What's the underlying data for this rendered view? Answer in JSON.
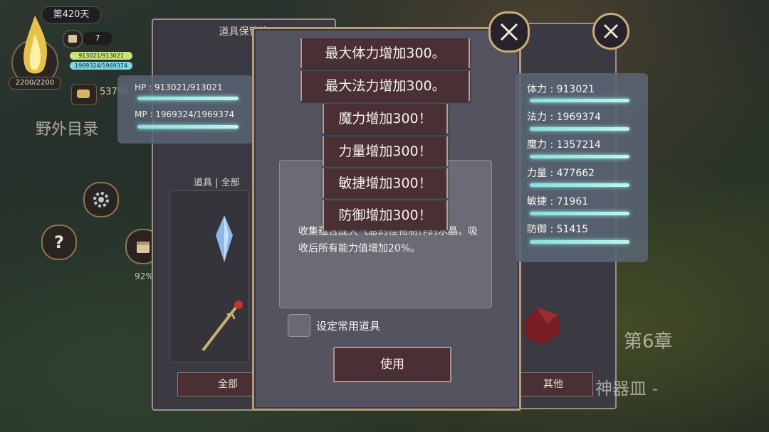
{
  "hud": {
    "day": "第420天",
    "orb_value": "2200/2200",
    "calendar_count": "7",
    "hp_mini": "913021/913021",
    "mp_mini": "1969324/1969374",
    "gold": "53796",
    "field_directory": "野外目录",
    "progress_pct": "92%"
  },
  "storage_panel": {
    "title": "道具保管箱",
    "tab_label": "道具 | 全部",
    "footer_all": "全部",
    "footer_other": "其他"
  },
  "stats_left": {
    "hp": "HP : 913021/913021",
    "mp": "MP : 1969324/1969374"
  },
  "stats_right": [
    {
      "label": "体力 : 913021"
    },
    {
      "label": "法力 : 1969374"
    },
    {
      "label": "魔力 : 1357214"
    },
    {
      "label": "力量 : 477662"
    },
    {
      "label": "敏捷 : 71961"
    },
    {
      "label": "防御 : 51415"
    }
  ],
  "popups": [
    "最大体力增加300。",
    "最大法力增加300。",
    "魔力增加300！",
    "力量增加300！",
    "敏捷增加300！",
    "防御增加300！"
  ],
  "dialog": {
    "description": "收集蕴含庞大气息的怪物制作的水晶。吸收后所有能力值增加20%。",
    "checkbox_label": "设定常用道具",
    "use_button": "使用"
  },
  "world": {
    "chapter": "第6章",
    "weapon_text": "神器皿 -"
  },
  "colors": {
    "glow_bar": "#8ef2e6",
    "button_bg": "#4a2f34",
    "frame_gold": "#c9ad7b"
  },
  "icons": [
    "flame-icon",
    "calendar-icon",
    "gold-icon",
    "gear-icon",
    "help-icon",
    "close-icon",
    "crystal-icon",
    "staff-icon",
    "ore-icon"
  ]
}
